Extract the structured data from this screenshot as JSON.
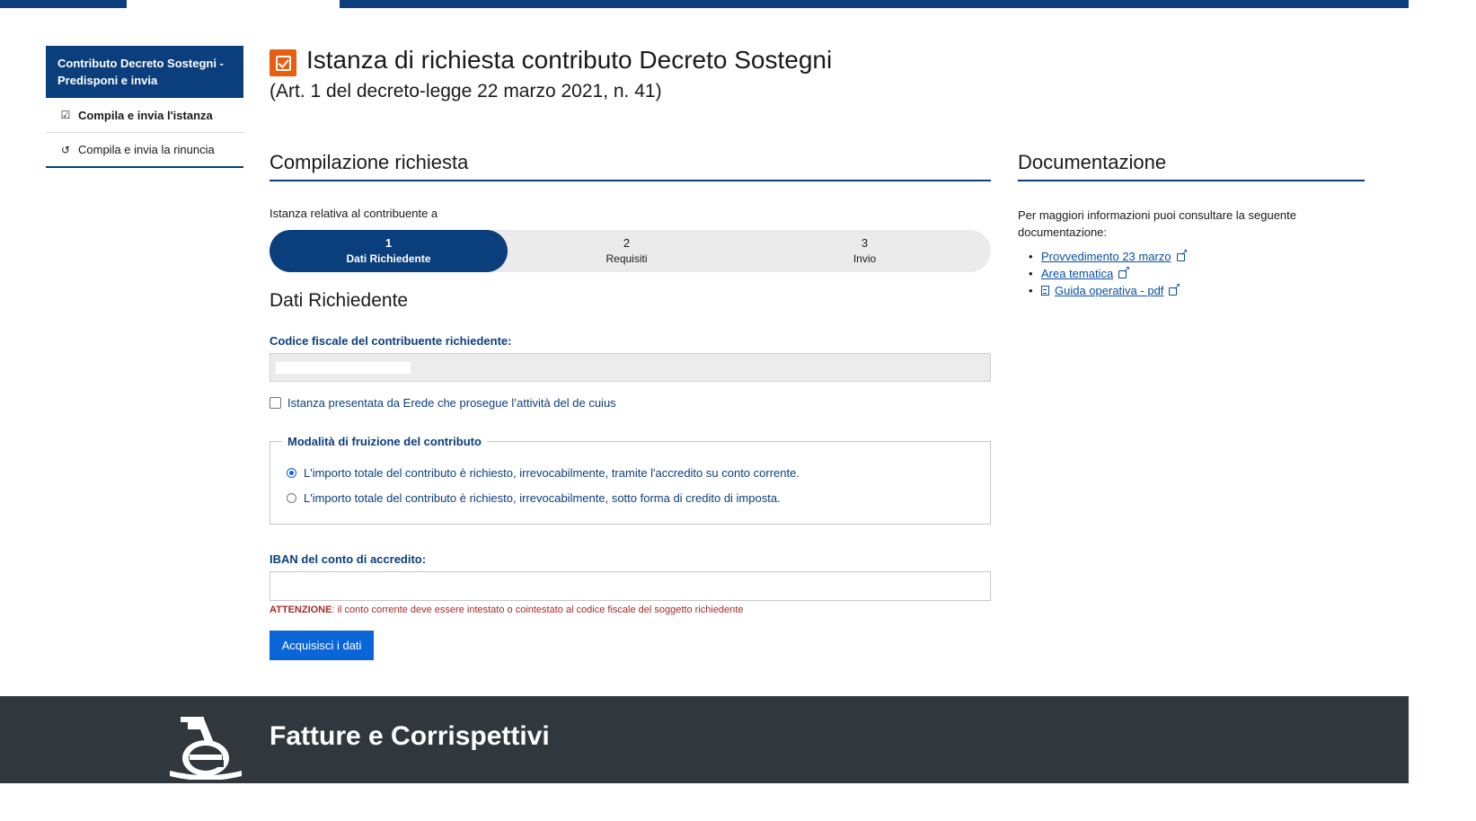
{
  "sidebar": {
    "header": "Contributo Decreto Sostegni - Predisponi e invia",
    "items": [
      {
        "label": "Compila e invia l'istanza",
        "icon": "checkbox-icon",
        "active": true
      },
      {
        "label": "Compila e invia la rinuncia",
        "icon": "undo-icon",
        "active": false
      }
    ]
  },
  "header": {
    "title": "Istanza di richiesta contributo Decreto Sostegni",
    "subtitle": "(Art. 1 del decreto-legge 22 marzo 2021, n. 41)",
    "icon": "checked-box-icon",
    "icon_color": "#e95e0f"
  },
  "main": {
    "section_title": "Compilazione richiesta",
    "context_text": "Istanza relativa al contribuente a",
    "steps": [
      {
        "number": "1",
        "label": "Dati Richiedente",
        "active": true
      },
      {
        "number": "2",
        "label": "Requisiti",
        "active": false
      },
      {
        "number": "3",
        "label": "Invio",
        "active": false
      }
    ],
    "form_title": "Dati Richiedente",
    "codice_fiscale_label": "Codice fiscale del contribuente richiedente:",
    "codice_fiscale_value": "",
    "erede_checkbox_label": "Istanza presentata da Erede che prosegue l’attività del de cuius",
    "erede_checked": false,
    "modalita": {
      "legend": "Modalità di fruizione del contributo",
      "options": [
        {
          "label": "L'importo totale del contributo è richiesto, irrevocabilmente, tramite l'accredito su conto corrente.",
          "selected": true
        },
        {
          "label": "L'importo totale del contributo è richiesto, irrevocabilmente, sotto forma di credito di imposta.",
          "selected": false
        }
      ]
    },
    "iban_label": "IBAN del conto di accredito:",
    "iban_value": "",
    "warning_strong": "ATTENZIONE",
    "warning_text": ": il conto corrente deve essere intestato o cointestato al codice fiscale del soggetto richiedente",
    "submit_label": "Acquisisci i dati"
  },
  "documentation": {
    "title": "Documentazione",
    "intro": "Per maggiori informazioni puoi consultare la seguente documentazione:",
    "links": [
      {
        "label": "Provvedimento 23 marzo",
        "icon": "external-link-icon"
      },
      {
        "label": "Area tematica",
        "icon": "external-link-icon"
      },
      {
        "label": "Guida operativa - pdf",
        "icon": "external-link-icon",
        "prefix_icon": "pdf-file-icon"
      }
    ]
  },
  "footer": {
    "brand": "Fatture e Corrispettivi",
    "logo": "agenzia-entrate-logo"
  },
  "colors": {
    "primary": "#0b3e7d",
    "button": "#0a66d6",
    "accent": "#e95e0f",
    "warning": "#a52a2a",
    "footer_bg": "#30373d"
  }
}
